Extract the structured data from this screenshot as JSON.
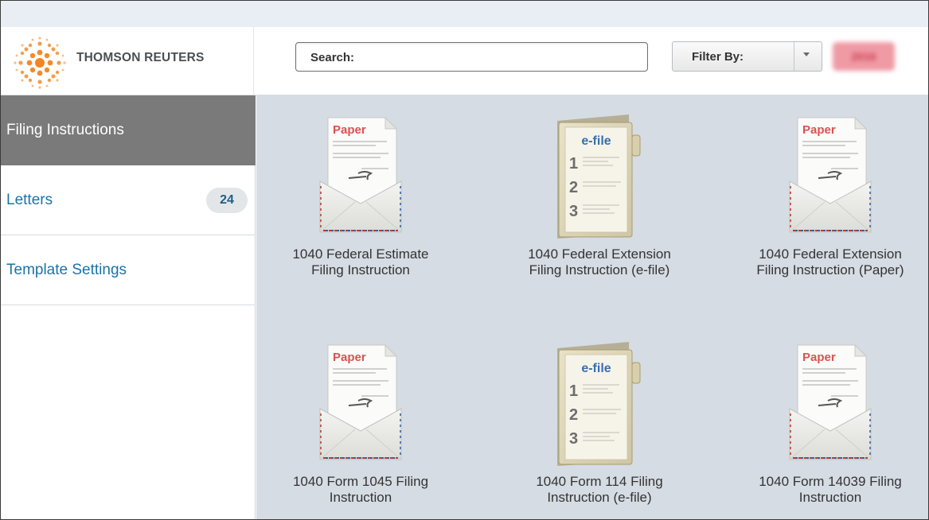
{
  "brand": {
    "name": "THOMSON REUTERS",
    "logo_icon": "thomson-reuters-logo-icon",
    "logo_color": "#f5841f"
  },
  "search": {
    "label": "Search:",
    "value": ""
  },
  "filter": {
    "label": "Filter By:",
    "arrow_icon": "chevron-down-icon"
  },
  "year_badge": {
    "value": "2016",
    "blurred": true,
    "color": "#ef9aa4"
  },
  "sidebar": {
    "items": [
      {
        "label": "Filing Instructions",
        "active": true
      },
      {
        "label": "Letters",
        "count": "24",
        "active": false
      },
      {
        "label": "Template Settings",
        "active": false
      }
    ]
  },
  "templates": [
    {
      "line1": "1040 Federal Estimate",
      "line2": "Filing Instruction",
      "icon": "paper-envelope-icon",
      "badge": "Paper"
    },
    {
      "line1": "1040 Federal Extension",
      "line2": "Filing Instruction (e-file)",
      "icon": "efile-folder-icon",
      "badge": "e-file"
    },
    {
      "line1": "1040 Federal Extension",
      "line2": "Filing Instruction (Paper)",
      "icon": "paper-envelope-icon",
      "badge": "Paper"
    },
    {
      "line1": "1040 Form 1045 Filing",
      "line2": "Instruction",
      "icon": "paper-envelope-icon",
      "badge": "Paper"
    },
    {
      "line1": "1040 Form 114 Filing",
      "line2": "Instruction (e-file)",
      "icon": "efile-folder-icon",
      "badge": "e-file"
    },
    {
      "line1": "1040 Form 14039 Filing",
      "line2": "Instruction",
      "icon": "paper-envelope-icon",
      "badge": "Paper"
    }
  ],
  "efile_steps": [
    "1",
    "2",
    "3"
  ],
  "colors": {
    "active_nav": "#7a7a7a",
    "link": "#1a73a8",
    "paper_red": "#d9534f",
    "efile_blue": "#3a6fb0",
    "grid_bg": "#d6dce3"
  }
}
